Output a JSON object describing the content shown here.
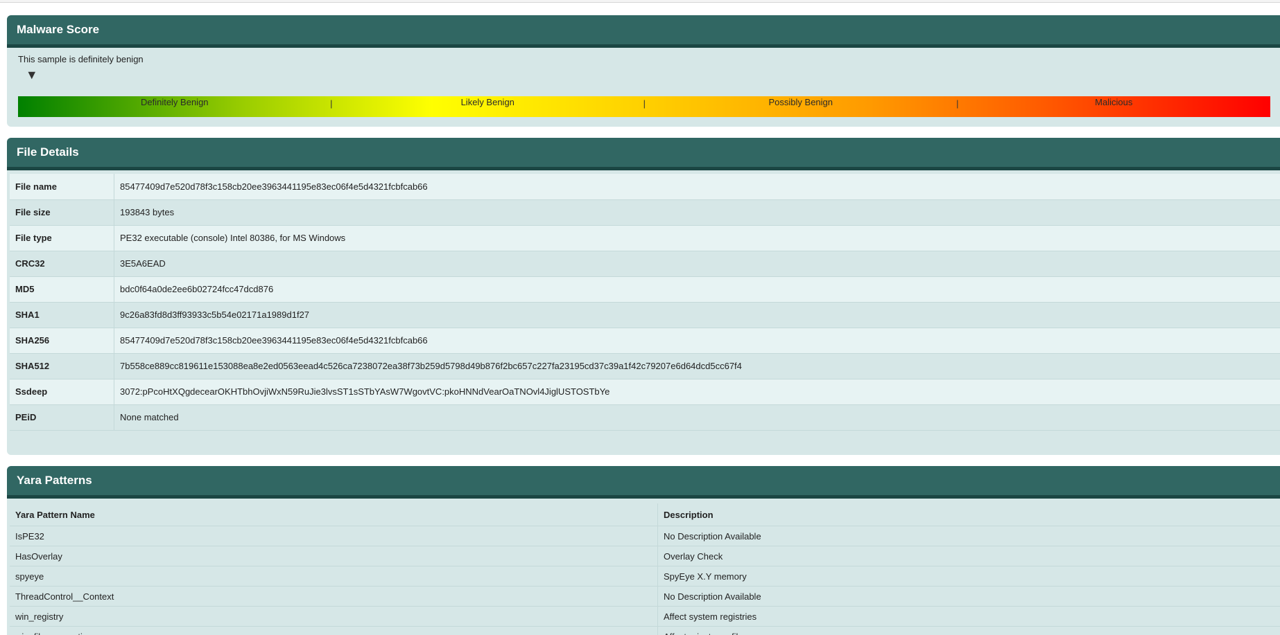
{
  "malware_score": {
    "title": "Malware Score",
    "verdict_text": "This sample is definitely benign",
    "marker_glyph": "▼",
    "score_position": 0.006,
    "segments": [
      {
        "label": "Definitely Benign",
        "separator": "|"
      },
      {
        "label": "Likely Benign",
        "separator": "|"
      },
      {
        "label": "Possibly Benign",
        "separator": "|"
      },
      {
        "label": "Malicious",
        "separator": ""
      }
    ],
    "colors": {
      "start": "#008000",
      "middle": "#ffff00",
      "end": "#ff0000",
      "header": "#316763",
      "panel": "#d6e7e7"
    }
  },
  "file_details": {
    "title": "File Details",
    "rows": [
      {
        "key": "File name",
        "value": "85477409d7e520d78f3c158cb20ee3963441195e83ec06f4e5d4321fcbfcab66"
      },
      {
        "key": "File size",
        "value": "193843 bytes"
      },
      {
        "key": "File type",
        "value": "PE32 executable (console) Intel 80386, for MS Windows"
      },
      {
        "key": "CRC32",
        "value": "3E5A6EAD"
      },
      {
        "key": "MD5",
        "value": "bdc0f64a0de2ee6b02724fcc47dcd876"
      },
      {
        "key": "SHA1",
        "value": "9c26a83fd8d3ff93933c5b54e02171a1989d1f27"
      },
      {
        "key": "SHA256",
        "value": "85477409d7e520d78f3c158cb20ee3963441195e83ec06f4e5d4321fcbfcab66"
      },
      {
        "key": "SHA512",
        "value": "7b558ce889cc819611e153088ea8e2ed0563eead4c526ca7238072ea38f73b259d5798d49b876f2bc657c227fa23195cd37c39a1f42c79207e6d64dcd5cc67f4"
      },
      {
        "key": "Ssdeep",
        "value": "3072:pPcoHtXQgdecearOKHTbhOvjiWxN59RuJie3lvsST1sSTbYAsW7WgovtVC:pkoHNNdVearOaTNOvl4JiglUSTOSTbYe"
      },
      {
        "key": "PEiD",
        "value": "None matched"
      }
    ]
  },
  "yara_patterns": {
    "title": "Yara Patterns",
    "headers": {
      "name": "Yara Pattern Name",
      "description": "Description"
    },
    "rows": [
      {
        "name": "IsPE32",
        "description": "No Description Available"
      },
      {
        "name": "HasOverlay",
        "description": "Overlay Check"
      },
      {
        "name": "spyeye",
        "description": "SpyEye X.Y memory"
      },
      {
        "name": "ThreadControl__Context",
        "description": "No Description Available"
      },
      {
        "name": "win_registry",
        "description": "Affect system registries"
      },
      {
        "name": "win_files_operation",
        "description": "Affect private profile"
      }
    ]
  }
}
